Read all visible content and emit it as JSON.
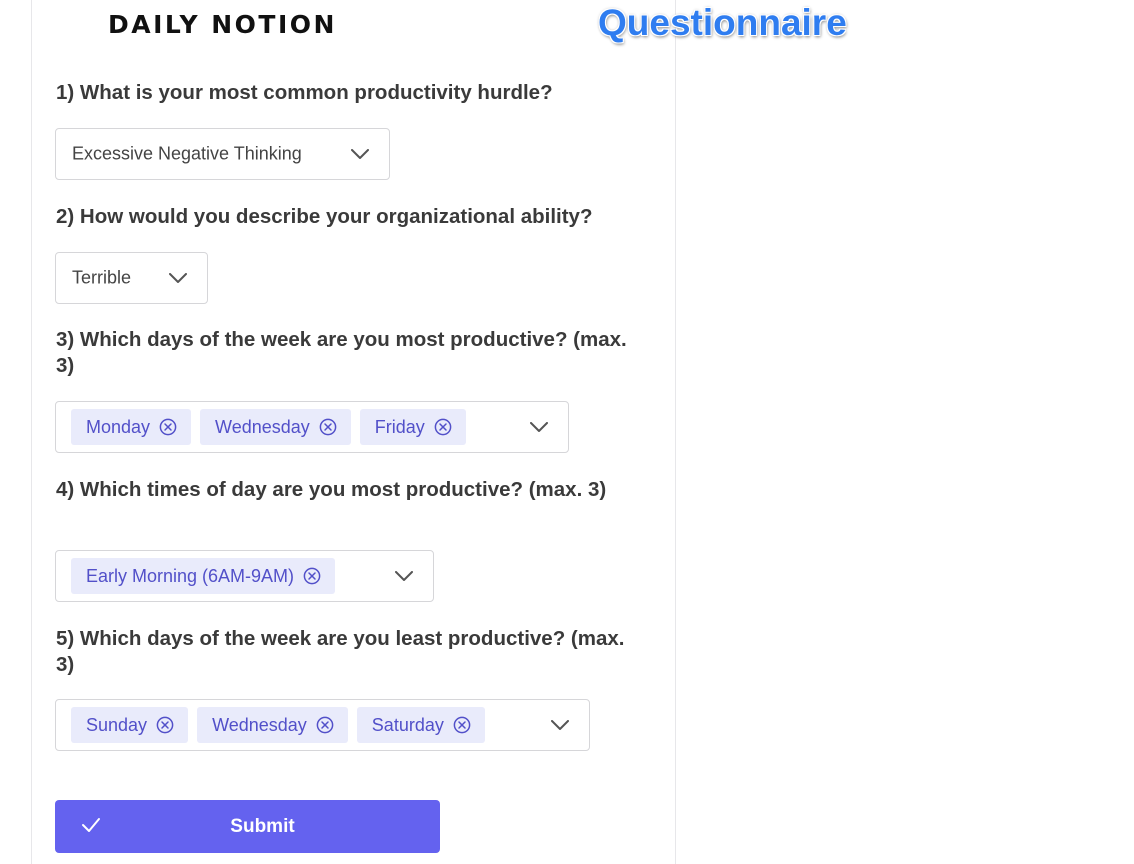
{
  "header": {
    "logo_text": "DAILY NOTION",
    "overlay_title": "Questionnaire"
  },
  "questions": [
    {
      "text": "1) What is your most common productivity hurdle?",
      "type": "select",
      "selected": "Excessive Negative Thinking"
    },
    {
      "text": "2) How would you describe your organizational ability?",
      "type": "select",
      "selected": "Terrible"
    },
    {
      "text": "3) Which days of the week are you most productive? (max. 3)",
      "type": "multiselect",
      "chips": [
        "Monday",
        "Wednesday",
        "Friday"
      ]
    },
    {
      "text": "4) Which times of day are you most productive? (max. 3)",
      "type": "multiselect",
      "chips": [
        "Early Morning (6AM-9AM)"
      ]
    },
    {
      "text": "5) Which days of the week are you least productive? (max. 3)",
      "type": "multiselect",
      "chips": [
        "Sunday",
        "Wednesday",
        "Saturday"
      ]
    }
  ],
  "submit": {
    "label": "Submit",
    "icon": "check-icon"
  },
  "icons": {
    "dropdown": "chevron-down-icon",
    "chip_remove": "circle-x-icon"
  },
  "colors": {
    "accent": "#6462ef",
    "chip_bg": "#e9ebfb",
    "chip_text": "#5250c9",
    "overlay_title": "#2f7df0"
  }
}
